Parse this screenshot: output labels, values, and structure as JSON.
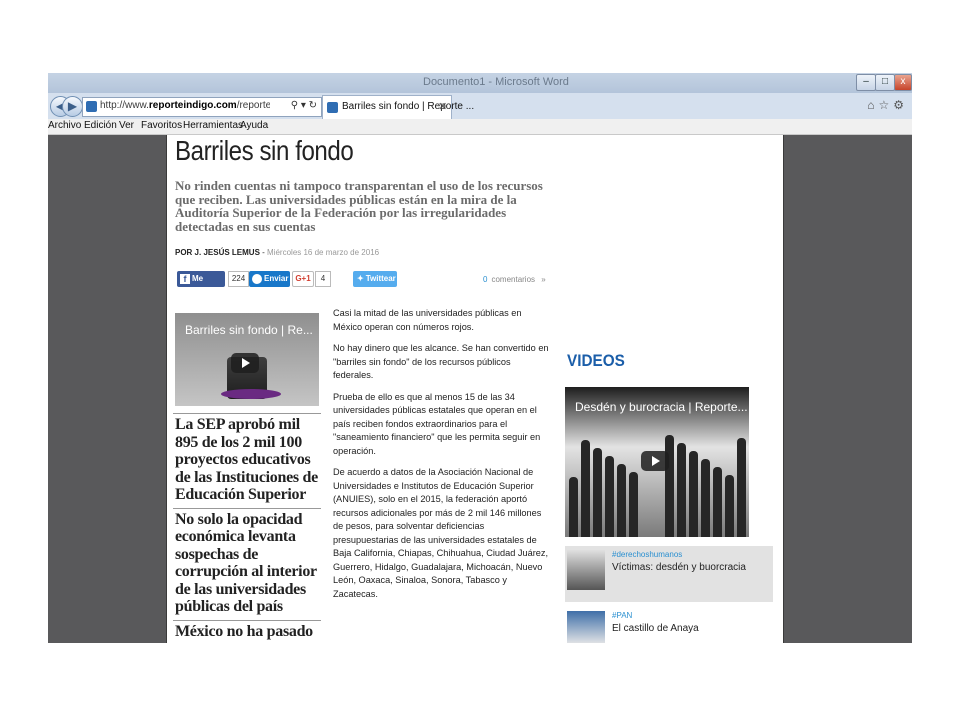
{
  "window": {
    "title": "Documento1 - Microsoft Word",
    "buttons": [
      "–",
      "□",
      "x"
    ]
  },
  "browser": {
    "url_prefix": "http://www.",
    "url_domain": "reporteindigo.com",
    "url_rest": "/reporte/mexico/barrile",
    "addr_icons": "⚲ ▾ ↻",
    "tab_label": "Barriles sin fondo | Reporte ...",
    "tab_close": "✕",
    "back": "◀",
    "forward": "▶",
    "right_icons": "⌂☆⚙",
    "menu": [
      "Archivo",
      "Edición",
      "Ver",
      "Favoritos",
      "Herramientas",
      "Ayuda"
    ]
  },
  "article": {
    "headline": "Barriles sin fondo",
    "summary": "No rinden cuentas ni tampoco transparentan el uso de los recursos que reciben. Las universidades públicas están en la mira de la Auditoría Superior de la Federación por las irregularidades detectadas en sus cuentas",
    "byline_author": "POR J. JESÚS LEMUS",
    "byline_date": "Miércoles 16 de marzo de 2016",
    "share": {
      "facebook": "Me gusta",
      "facebook_count": "224",
      "messenger": "Enviar",
      "google": "G+1",
      "google_count": "4",
      "twitter": "Twittear"
    },
    "comments_count": "0",
    "comments_label": "comentarios",
    "comments_icon": "»",
    "video_title": "Barriles sin fondo | Re...",
    "related": [
      "La SEP aprobó mil 895 de los 2 mil 100 proyectos educativos de las Instituciones de Educación Superior",
      "No solo la opacidad económica levanta sospechas de corrupción al interior de las universidades públicas del país",
      "México no ha pasado"
    ],
    "paragraphs": [
      "Casi la mitad de las universidades públicas en México operan con números rojos.",
      "No hay dinero que les alcance. Se han convertido en \"barriles sin fondo\" de los recursos públicos federales.",
      "Prueba de ello es que al menos 15 de las 34 universidades públicas estatales que operan en el país reciben fondos extraordinarios para el \"saneamiento financiero\" que les permita seguir en operación.",
      "De acuerdo a datos de la Asociación Nacional de Universidades e Institutos de Educación Superior (ANUIES), solo en el 2015, la federación aportó recursos adicionales por más de 2 mil 146 millones de pesos, para solventar deficiencias presupuestarias de las universidades estatales de Baja California, Chiapas, Chihuahua, Ciudad Juárez, Guerrero, Hidalgo, Guadalajara, Michoacán, Nuevo León, Oaxaca, Sinaloa, Sonora, Tabasco y Zacatecas."
    ]
  },
  "videos": {
    "title": "VIDEOS",
    "video_title": "Desdén y burocracia | Reporte...",
    "items": [
      {
        "tag": "#derechoshumanos",
        "title": "Víctimas: desdén y buorcracia"
      },
      {
        "tag": "#PAN",
        "title": "El castillo de Anaya"
      }
    ]
  },
  "colors": {
    "link_blue": "#1b5ea9",
    "facebook": "#3b5998",
    "twitter": "#55acee",
    "frame": "#59595b"
  }
}
